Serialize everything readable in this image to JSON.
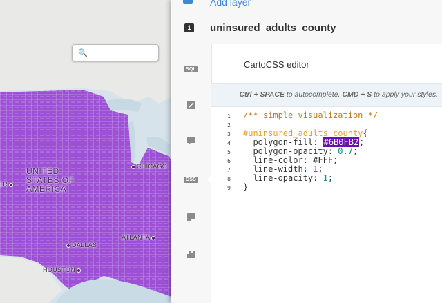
{
  "map": {
    "search_placeholder": "",
    "country_label_line1": "UNITED",
    "country_label_line2": "STATES OF",
    "country_label_line3": "AMERICA",
    "cities": {
      "chicago": "CHICAGO",
      "dallas": "DALLAS",
      "atlanta": "ATLANTA",
      "houston": "HOUSTON",
      "denver_partial": "ER"
    },
    "fill_color": "#6B0FB2",
    "water_color": "#d7e3ea",
    "land_color": "#e8e8e8"
  },
  "panel": {
    "add_layer": "Add layer",
    "layer_number": "1",
    "layer_name": "uninsured_adults_county",
    "tools": [
      {
        "name": "sql",
        "label": "SQL"
      },
      {
        "name": "wizard",
        "icon": "paintbrush-icon"
      },
      {
        "name": "infowindow",
        "icon": "speech-bubble-icon"
      },
      {
        "name": "css",
        "label": "CSS",
        "active": true
      },
      {
        "name": "legend",
        "icon": "legend-icon"
      },
      {
        "name": "filters",
        "icon": "bar-chart-icon"
      }
    ],
    "editor_title": "CartoCSS editor",
    "hint_prefix": "Ctrl + SPACE",
    "hint_mid": " to autocomplete. ",
    "hint_key2": "CMD + S",
    "hint_suffix": " to apply your styles.",
    "line_numbers": [
      "1",
      "2",
      "3",
      "4",
      "5",
      "6",
      "7",
      "8",
      "9"
    ],
    "code": {
      "l1": "/** simple visualization */",
      "l3_selector": "#uninsured_adults_county",
      "l3_brace": "{",
      "l4_prop": "  polygon-fill: ",
      "l4_value": "#6B0FB2",
      "l4_end": ";",
      "l5_prop": "  polygon-opacity: ",
      "l5_value": "0.7",
      "l5_end": ";",
      "l6": "  line-color: #FFF;",
      "l7_prop": "  line-width: ",
      "l7_value": "1",
      "l7_end": ";",
      "l8_prop": "  line-opacity: ",
      "l8_value": "1",
      "l8_end": ";",
      "l9": "}"
    }
  }
}
